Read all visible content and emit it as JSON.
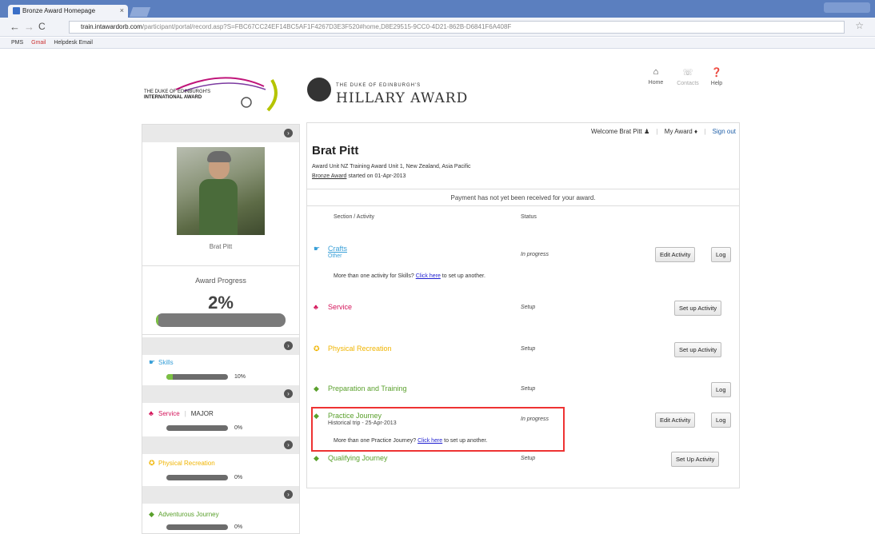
{
  "browser": {
    "tab_title": "Bronze Award Homepage",
    "tab_close": "×",
    "url_host": "train.intawardorb.com",
    "url_rest": "/participant/portal/record.asp?S=FBC67CC24EF14BC5AF1F4267D3E3F520#home,D8E29515-9CC0-4D21-862B-D6841F6A408F",
    "bookmarks": [
      "PMS",
      "Gmail",
      "Helpdesk Email"
    ]
  },
  "header": {
    "intl_line1": "THE DUKE OF EDINBURGH'S",
    "intl_line2": "INTERNATIONAL AWARD",
    "hillary_small": "THE DUKE OF EDINBURGH'S",
    "hillary_big": "HILLARY AWARD",
    "nav": [
      {
        "label": "Home",
        "icon": "home-icon"
      },
      {
        "label": "Contacts",
        "icon": "phone-icon"
      },
      {
        "label": "Help",
        "icon": "help-icon"
      }
    ]
  },
  "profile": {
    "name": "Brat Pitt",
    "award_progress_label": "Award Progress",
    "award_progress_value": "2%",
    "award_progress_fraction": 0.02
  },
  "sections": [
    {
      "name": "Skills",
      "extra": "",
      "pct": "10%",
      "fraction": 0.1,
      "color": "#3aa0d8"
    },
    {
      "name": "Service",
      "extra": "MAJOR",
      "pct": "0%",
      "fraction": 0.0,
      "color": "#d4145a"
    },
    {
      "name": "Physical Recreation",
      "extra": "",
      "pct": "0%",
      "fraction": 0.0,
      "color": "#f0b400"
    },
    {
      "name": "Adventurous Journey",
      "extra": "",
      "pct": "0%",
      "fraction": 0.0,
      "color": "#5aa02c"
    }
  ],
  "main": {
    "welcome": "Welcome Brat Pitt",
    "my_award": "My Award",
    "sign_out": "Sign out",
    "title": "Brat Pitt",
    "unit_line": "Award Unit NZ Training Award Unit 1, New Zealand, Asia Pacific",
    "started_award": "Bronze Award",
    "started_rest": " started on 01-Apr-2013",
    "payment_notice": "Payment has not yet been received for your award.",
    "col_section": "Section / Activity",
    "col_status": "Status",
    "activities": [
      {
        "name": "Crafts",
        "sub": "Other",
        "status": "In progress",
        "buttons": [
          "Edit Activity",
          "Log"
        ],
        "note_pre": "More than one activity for Skills? ",
        "note_link": "Click here",
        "note_post": " to set up another.",
        "color": "#3aa0d8"
      },
      {
        "name": "Service",
        "sub": "",
        "status": "Setup",
        "buttons": [
          "Set up Activity"
        ],
        "color": "#d4145a"
      },
      {
        "name": "Physical Recreation",
        "sub": "",
        "status": "Setup",
        "buttons": [
          "Set up Activity"
        ],
        "color": "#f0b400"
      },
      {
        "name": "Preparation and Training",
        "sub": "",
        "status": "Setup",
        "buttons": [
          "Log"
        ],
        "color": "#5aa02c"
      },
      {
        "name": "Practice Journey",
        "sub": "Historical trip - 25-Apr-2013",
        "status": "In progress",
        "buttons": [
          "Edit Activity",
          "Log"
        ],
        "note_pre": "More than one Practice Journey? ",
        "note_link": "Click here",
        "note_post": " to set up another.",
        "color": "#5aa02c"
      },
      {
        "name": "Qualifying Journey",
        "sub": "",
        "status": "Setup",
        "buttons": [
          "Set Up Activity"
        ],
        "color": "#5aa02c"
      }
    ]
  }
}
